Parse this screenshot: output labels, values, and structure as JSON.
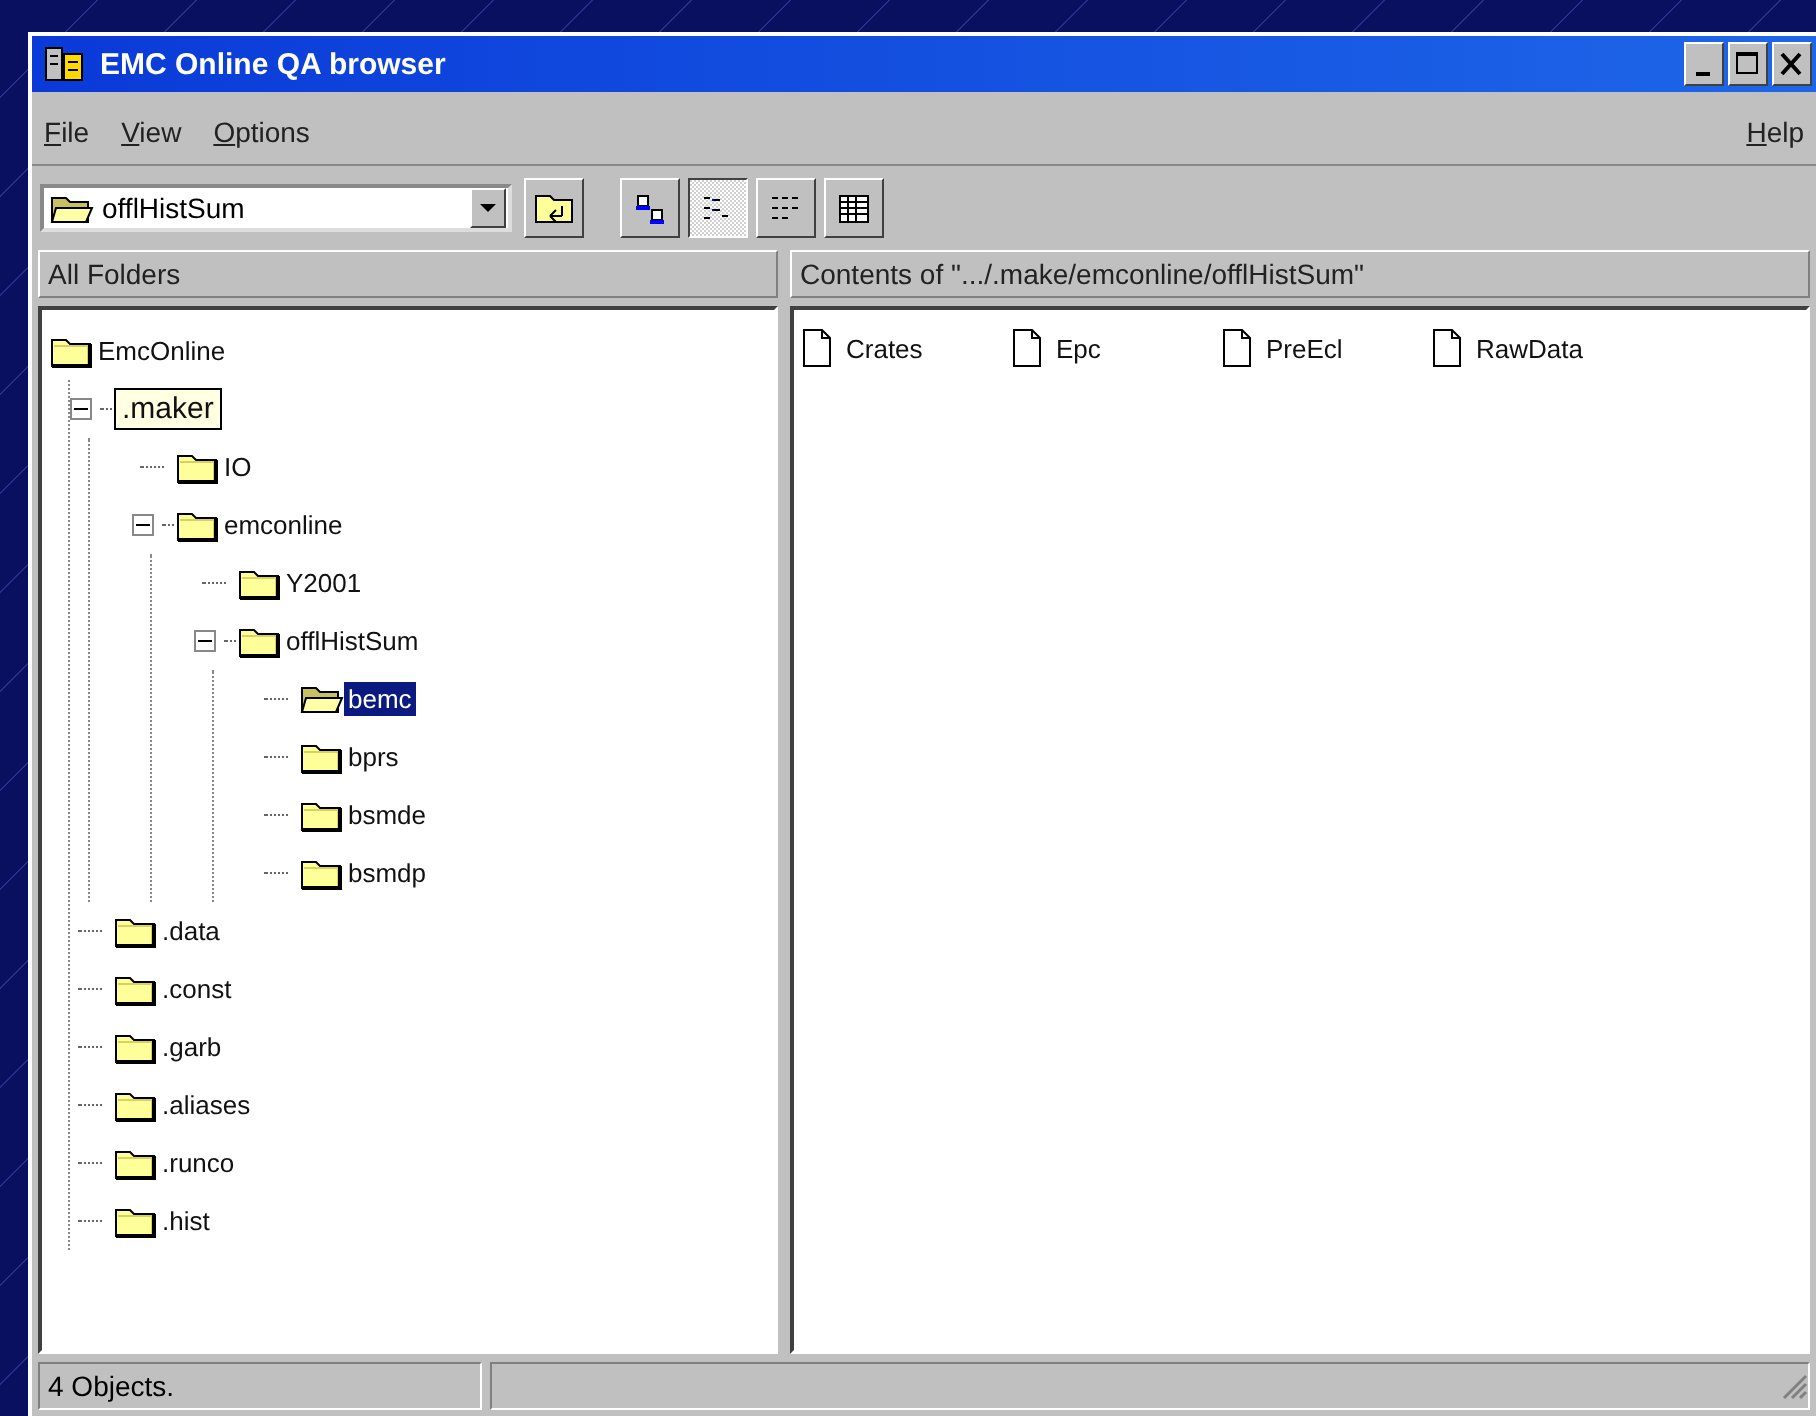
{
  "window": {
    "title": "EMC Online QA browser"
  },
  "menu": [
    {
      "label": "File"
    },
    {
      "label": "View"
    },
    {
      "label": "Options"
    },
    {
      "label": "Help"
    }
  ],
  "toolbar": {
    "location": "offlHistSum",
    "view_buttons": [
      {
        "kind": "large-icons",
        "selected": false
      },
      {
        "kind": "small-icons",
        "selected": true
      },
      {
        "kind": "list",
        "selected": false
      },
      {
        "kind": "details",
        "selected": false
      }
    ]
  },
  "tree_pane": {
    "header": "All Folders",
    "tree": [
      {
        "label": "EmcOnline",
        "kind": "root",
        "children": [
          {
            "label": ".maker",
            "kind": "tooltip",
            "expanded": true,
            "children": [
              {
                "label": "IO",
                "selected": false
              },
              {
                "label": "emconline",
                "expanded": true,
                "selected": false,
                "children": [
                  {
                    "label": "Y2001",
                    "selected": false
                  },
                  {
                    "label": "offlHistSum",
                    "expanded": true,
                    "selected": false,
                    "children": [
                      {
                        "label": "bemc",
                        "selected": true
                      },
                      {
                        "label": "bprs",
                        "selected": false
                      },
                      {
                        "label": "bsmde",
                        "selected": false
                      },
                      {
                        "label": "bsmdp",
                        "selected": false
                      }
                    ]
                  }
                ]
              }
            ]
          },
          {
            "label": ".data",
            "selected": false
          },
          {
            "label": ".const",
            "selected": false
          },
          {
            "label": ".garb",
            "selected": false
          },
          {
            "label": ".aliases",
            "selected": false
          },
          {
            "label": ".runco",
            "selected": false
          },
          {
            "label": ".hist",
            "selected": false
          }
        ]
      }
    ]
  },
  "contents_pane": {
    "header": "Contents of \".../.make/emconline/offlHistSum\"",
    "files": [
      {
        "name": "Crates"
      },
      {
        "name": "Epc"
      },
      {
        "name": "PreEcl"
      },
      {
        "name": "RawData"
      }
    ]
  },
  "status_bar": {
    "text": "4 Objects."
  }
}
